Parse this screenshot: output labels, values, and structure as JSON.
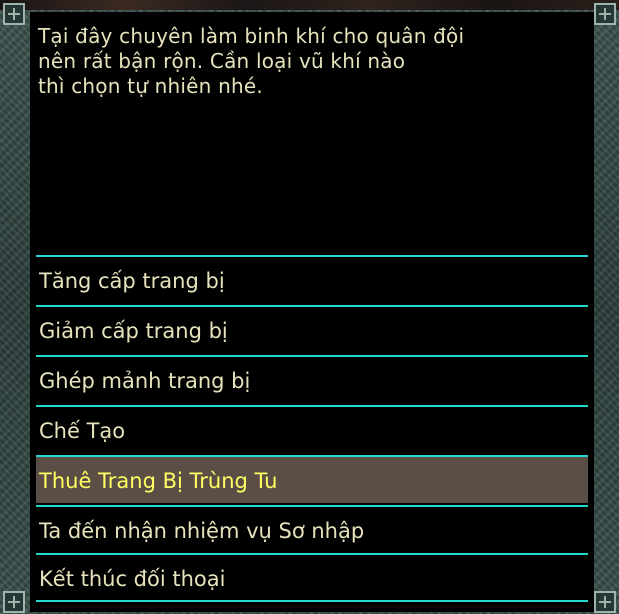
{
  "dialog": {
    "intro_text": "Tại đây chuyên làm binh khí cho quân đội\nnên rất bận rộn. Cần loại vũ khí nào\nthì chọn tự nhiên nhé.",
    "options": [
      {
        "label": "Tăng cấp trang bị"
      },
      {
        "label": "Giảm cấp trang bị"
      },
      {
        "label": "Ghép mảnh trang bị"
      },
      {
        "label": "Chế Tạo"
      },
      {
        "label": "Thuê Trang Bị Trùng Tu",
        "selected": true
      },
      {
        "label": "Ta đến nhận nhiệm vụ Sơ nhập"
      },
      {
        "label": "Kết thúc đối thoại"
      }
    ]
  },
  "colors": {
    "text": "#e6e2bc",
    "highlight_text": "#ffff63",
    "highlight_bg": "#5b4f45",
    "divider": "#24d8d2",
    "frame": "#3f5652"
  }
}
